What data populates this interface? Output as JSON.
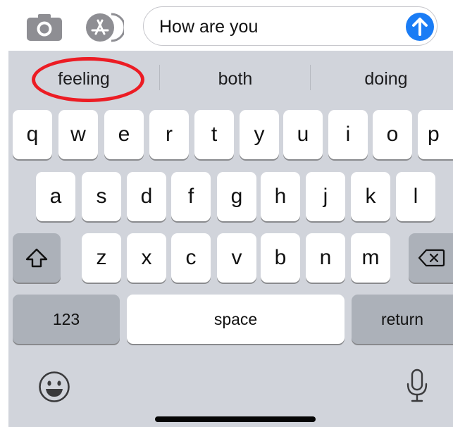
{
  "compose": {
    "text": "How are you",
    "camera_icon": "camera-icon",
    "app_icon": "app-store-icon",
    "send_icon": "arrow-up-icon",
    "accent_color": "#1a7cf5"
  },
  "predictive_bar": {
    "suggestions": [
      "feeling",
      "both",
      "doing"
    ],
    "highlight_color": "#ec1c24"
  },
  "keyboard": {
    "row1": [
      "q",
      "w",
      "e",
      "r",
      "t",
      "y",
      "u",
      "i",
      "o",
      "p"
    ],
    "row2": [
      "a",
      "s",
      "d",
      "f",
      "g",
      "h",
      "j",
      "k",
      "l"
    ],
    "row3": [
      "z",
      "x",
      "c",
      "v",
      "b",
      "n",
      "m"
    ],
    "shift_icon": "shift-icon",
    "delete_icon": "backspace-icon",
    "numbers_label": "123",
    "space_label": "space",
    "return_label": "return",
    "emoji_icon": "emoji-icon",
    "mic_icon": "microphone-icon"
  }
}
